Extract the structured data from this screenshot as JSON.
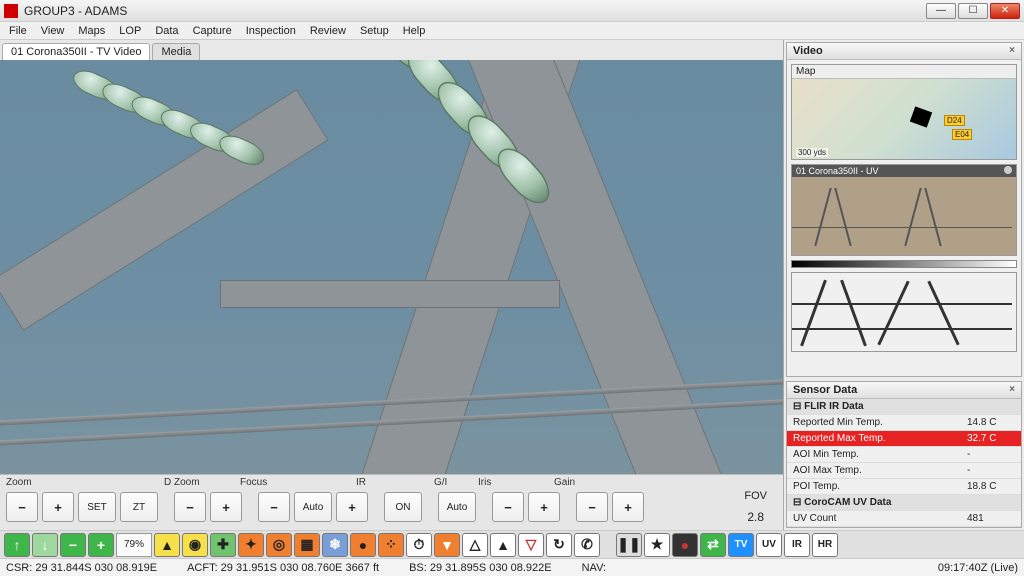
{
  "window": {
    "title": "GROUP3 - ADAMS"
  },
  "menu": [
    "File",
    "View",
    "Maps",
    "LOP",
    "Data",
    "Capture",
    "Inspection",
    "Review",
    "Setup",
    "Help"
  ],
  "tabs": {
    "active": "01 Corona350II - TV Video",
    "inactive": "Media"
  },
  "controls": {
    "labels": {
      "zoom": "Zoom",
      "dzoom": "D Zoom",
      "focus": "Focus",
      "ir": "IR",
      "gi": "G/I",
      "iris": "Iris",
      "gain": "Gain",
      "fov": "FOV"
    },
    "set": "SET",
    "zt": "ZT",
    "auto": "Auto",
    "on": "ON",
    "fov_value": "2.8"
  },
  "toolbar": {
    "pct": "79%",
    "buttons": [
      "up",
      "down",
      "minus",
      "plus",
      "pct",
      "nav-n",
      "target",
      "crosshair-g",
      "star-red",
      "target-ring",
      "grid",
      "snow",
      "dot",
      "dots4",
      "timer",
      "tri-down-o",
      "tri-up-w",
      "tri-up",
      "tri-down",
      "rotate",
      "handset",
      "pause",
      "star-k",
      "record",
      "swap",
      "tv",
      "uv",
      "ir",
      "hr"
    ],
    "tv": "TV",
    "uv": "UV",
    "ir": "IR",
    "hr": "HR"
  },
  "status": {
    "csr": "CSR: 29 31.844S  030 08.919E",
    "acft": "ACFT: 29 31.951S  030 08.760E  3667 ft",
    "bs": "BS: 29 31.895S  030 08.922E",
    "nav": "NAV:",
    "time": "09:17:40Z (Live)"
  },
  "right": {
    "video_panel": "Video",
    "map_title": "Map",
    "map_scale": "300 yds",
    "map_label1": "D24",
    "map_label2": "E04",
    "thumb1_title": "01 Corona350II - UV",
    "sensor_panel": "Sensor Data",
    "groups": {
      "flir": "FLIR IR Data",
      "coro": "CoroCAM UV Data"
    },
    "rows": {
      "rep_min": {
        "k": "Reported Min Temp.",
        "v": "14.8 C"
      },
      "rep_max": {
        "k": "Reported Max Temp.",
        "v": "32.7 C"
      },
      "aoi_min": {
        "k": "AOI Min Temp.",
        "v": "-"
      },
      "aoi_max": {
        "k": "AOI Max Temp.",
        "v": "-"
      },
      "poi": {
        "k": "POI Temp.",
        "v": "18.8 C"
      },
      "uv_count": {
        "k": "UV Count",
        "v": "481"
      }
    }
  }
}
